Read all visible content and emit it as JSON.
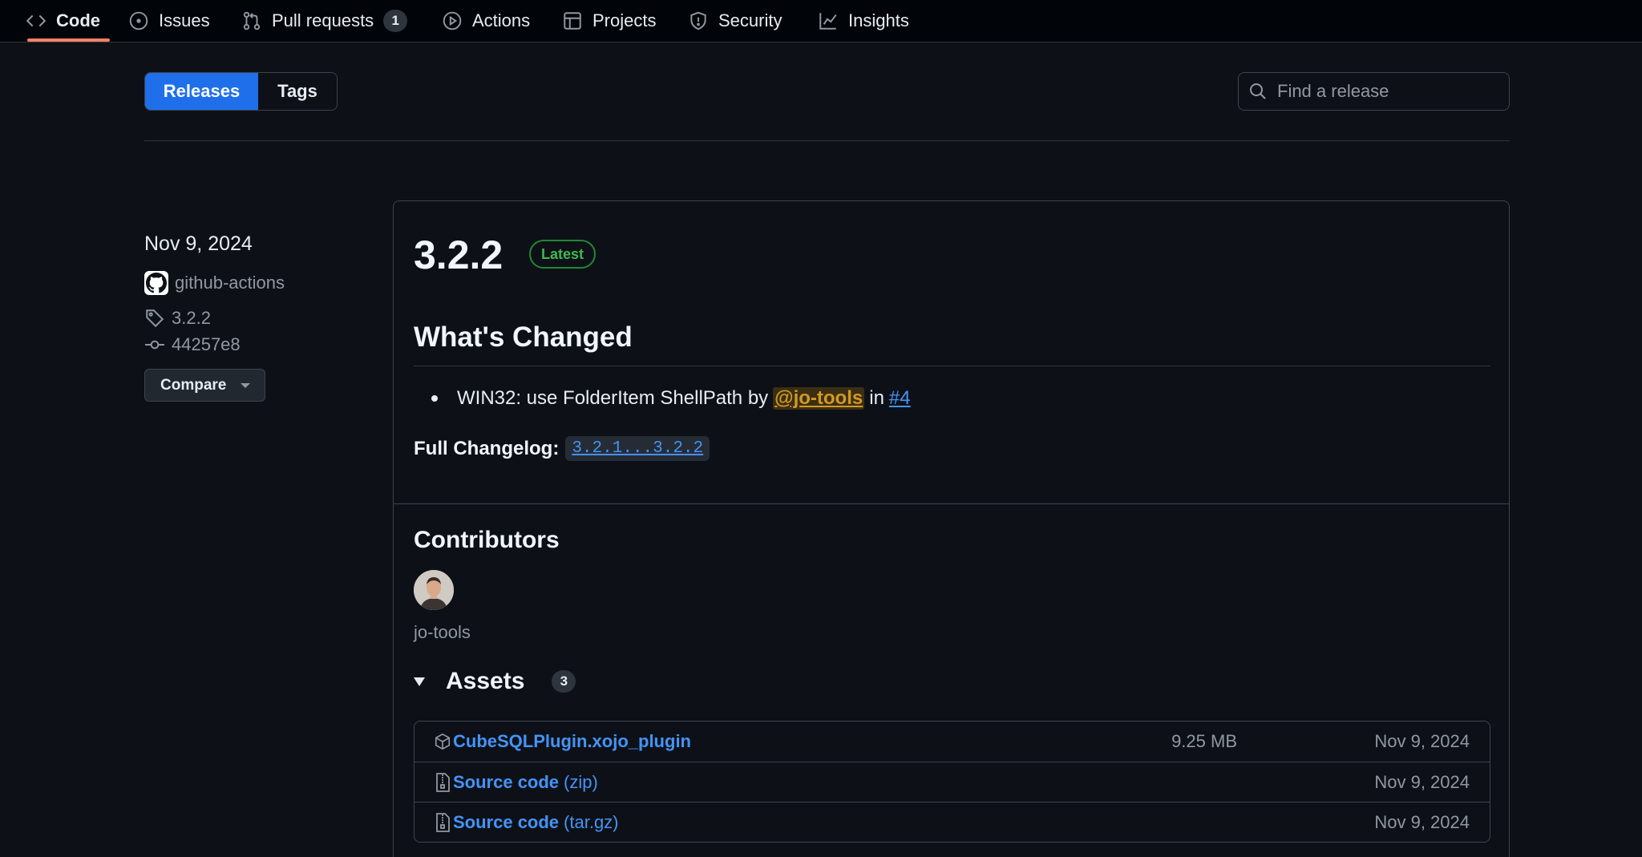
{
  "nav": {
    "tabs": [
      {
        "label": "Code",
        "icon": "code-icon",
        "active": true
      },
      {
        "label": "Issues",
        "icon": "issue-icon"
      },
      {
        "label": "Pull requests",
        "icon": "pull-request-icon",
        "count": "1"
      },
      {
        "label": "Actions",
        "icon": "play-icon"
      },
      {
        "label": "Projects",
        "icon": "table-icon"
      },
      {
        "label": "Security",
        "icon": "shield-icon"
      },
      {
        "label": "Insights",
        "icon": "graph-icon"
      }
    ]
  },
  "subnav": {
    "releases": "Releases",
    "tags": "Tags"
  },
  "search": {
    "placeholder": "Find a release"
  },
  "meta": {
    "date": "Nov 9, 2024",
    "author": "github-actions",
    "tag": "3.2.2",
    "commit": "44257e8",
    "compare_label": "Compare"
  },
  "release": {
    "version": "3.2.2",
    "badge": "Latest",
    "heading": "What's Changed",
    "change": {
      "text": "WIN32: use FolderItem ShellPath by",
      "mention": "@jo-tools",
      "in": "in",
      "issue": "#4"
    },
    "changelog_label": "Full Changelog:",
    "changelog_link": "3.2.1...3.2.2",
    "contributors_heading": "Contributors",
    "contributor": "jo-tools",
    "assets_heading": "Assets",
    "assets_count": "3",
    "assets": [
      {
        "name": "CubeSQLPlugin.xojo_plugin",
        "suffix": "",
        "size": "9.25 MB",
        "date": "Nov 9, 2024",
        "icon": "package-icon"
      },
      {
        "name": "Source code",
        "suffix": "(zip)",
        "size": "",
        "date": "Nov 9, 2024",
        "icon": "file-zip-icon"
      },
      {
        "name": "Source code",
        "suffix": "(tar.gz)",
        "size": "",
        "date": "Nov 9, 2024",
        "icon": "file-zip-icon"
      }
    ]
  },
  "colors": {
    "background": "#0d1117",
    "accent": "#1f6feb",
    "link": "#4493f8",
    "success": "#3fb950",
    "active_tab_underline": "#f78166",
    "mention": "#d29922"
  }
}
